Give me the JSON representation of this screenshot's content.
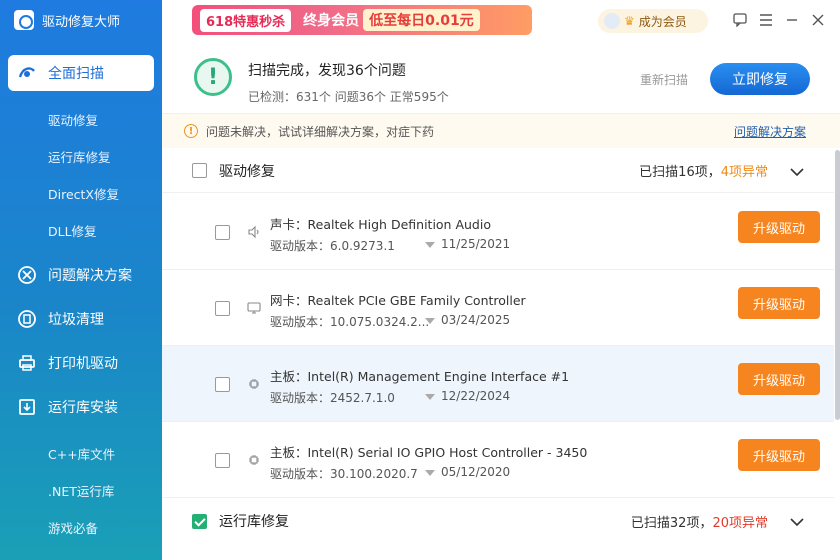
{
  "app": {
    "title": "驱动修复大师"
  },
  "sidebar": {
    "main_items": [
      {
        "label": "全面扫描",
        "icon": "scan-icon"
      },
      {
        "label": "问题解决方案",
        "icon": "solution-icon"
      },
      {
        "label": "垃圾清理",
        "icon": "clean-icon"
      },
      {
        "label": "打印机驱动",
        "icon": "printer-icon"
      },
      {
        "label": "运行库安装",
        "icon": "install-icon"
      }
    ],
    "scan_subitems": [
      "驱动修复",
      "运行库修复",
      "DirectX修复",
      "DLL修复"
    ],
    "runtime_subitems": [
      "C++库文件",
      ".NET运行库",
      "游戏必备"
    ]
  },
  "promo": {
    "tag": "618特惠秒杀",
    "text": "终身会员",
    "highlight": "低至每日0.01元"
  },
  "vip": {
    "label": "成为会员"
  },
  "scan": {
    "title": "扫描完成，发现36个问题",
    "summary": "已检测：631个 问题36个 正常595个",
    "rescan_label": "重新扫描",
    "fix_now_label": "立即修复"
  },
  "notice": {
    "text": "问题未解决，试试详细解决方案，对症下药",
    "link": "问题解决方案"
  },
  "sections": [
    {
      "label": "驱动修复",
      "scanned": "已扫描16项，",
      "issues": "4项异常",
      "checked": false,
      "issue_color": "#f08a1a"
    },
    {
      "label": "运行库修复",
      "scanned": "已扫描32项，",
      "issues": "20项异常",
      "checked": true,
      "issue_color": "#e23a2a"
    }
  ],
  "drivers": [
    {
      "name": "声卡：Realtek High Definition Audio",
      "version": "驱动版本：6.0.9273.1",
      "date": "11/25/2021",
      "icon": "speaker-icon"
    },
    {
      "name": "网卡：Realtek PCIe GBE Family Controller",
      "version": "驱动版本：10.075.0324.2...",
      "date": "03/24/2025",
      "icon": "network-icon"
    },
    {
      "name": "主板：Intel(R) Management Engine Interface #1",
      "version": "驱动版本：2452.7.1.0",
      "date": "12/22/2024",
      "icon": "chip-icon"
    },
    {
      "name": "主板：Intel(R) Serial IO GPIO Host Controller - 3450",
      "version": "驱动版本：30.100.2020.7",
      "date": "05/12/2020",
      "icon": "chip-icon"
    }
  ],
  "upgrade_label": "升级驱动"
}
